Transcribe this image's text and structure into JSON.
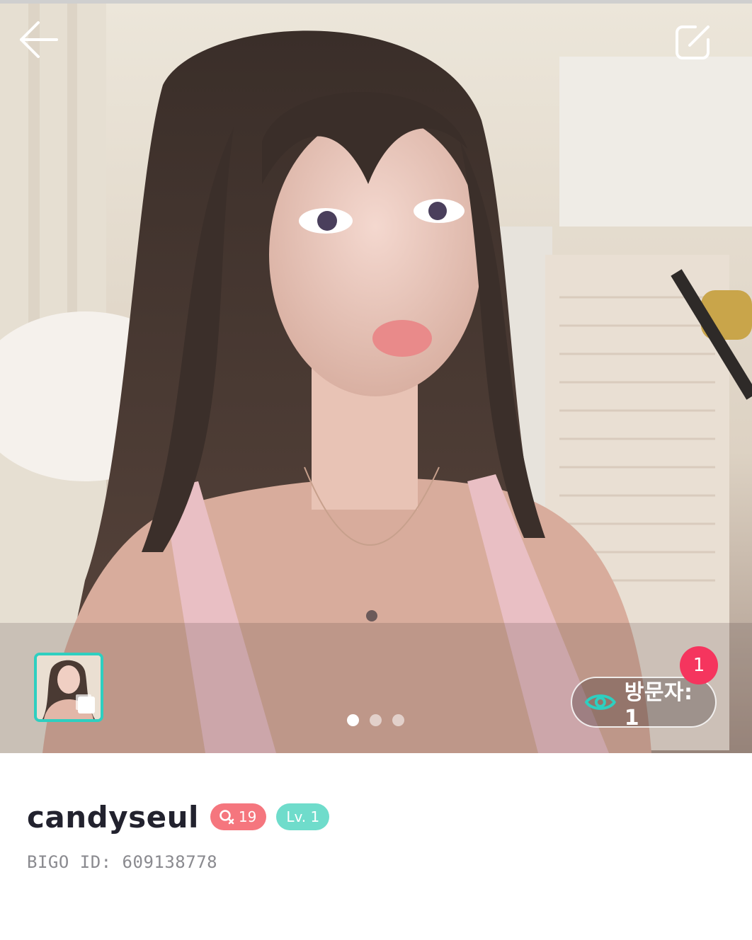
{
  "header": {
    "back_icon": "arrow-left-icon",
    "edit_icon": "edit-square-icon"
  },
  "gallery": {
    "photo_count": 3,
    "active_index": 0,
    "thumbnail_icon": "multi-photo-icon"
  },
  "visitors": {
    "label": "방문자: 1",
    "new_count": "1",
    "icon": "eye-icon"
  },
  "profile": {
    "username": "candyseul",
    "gender_age": "19",
    "gender_icon": "female-icon",
    "level": "Lv. 1",
    "bigo_id": "BIGO ID: 609138778"
  },
  "colors": {
    "accent_teal": "#2ecfc0",
    "badge_red": "#f5355e",
    "gender_badge": "#f5767e",
    "level_badge": "#6fdccb",
    "username": "#22222e",
    "id_text": "#8a8a8f"
  }
}
